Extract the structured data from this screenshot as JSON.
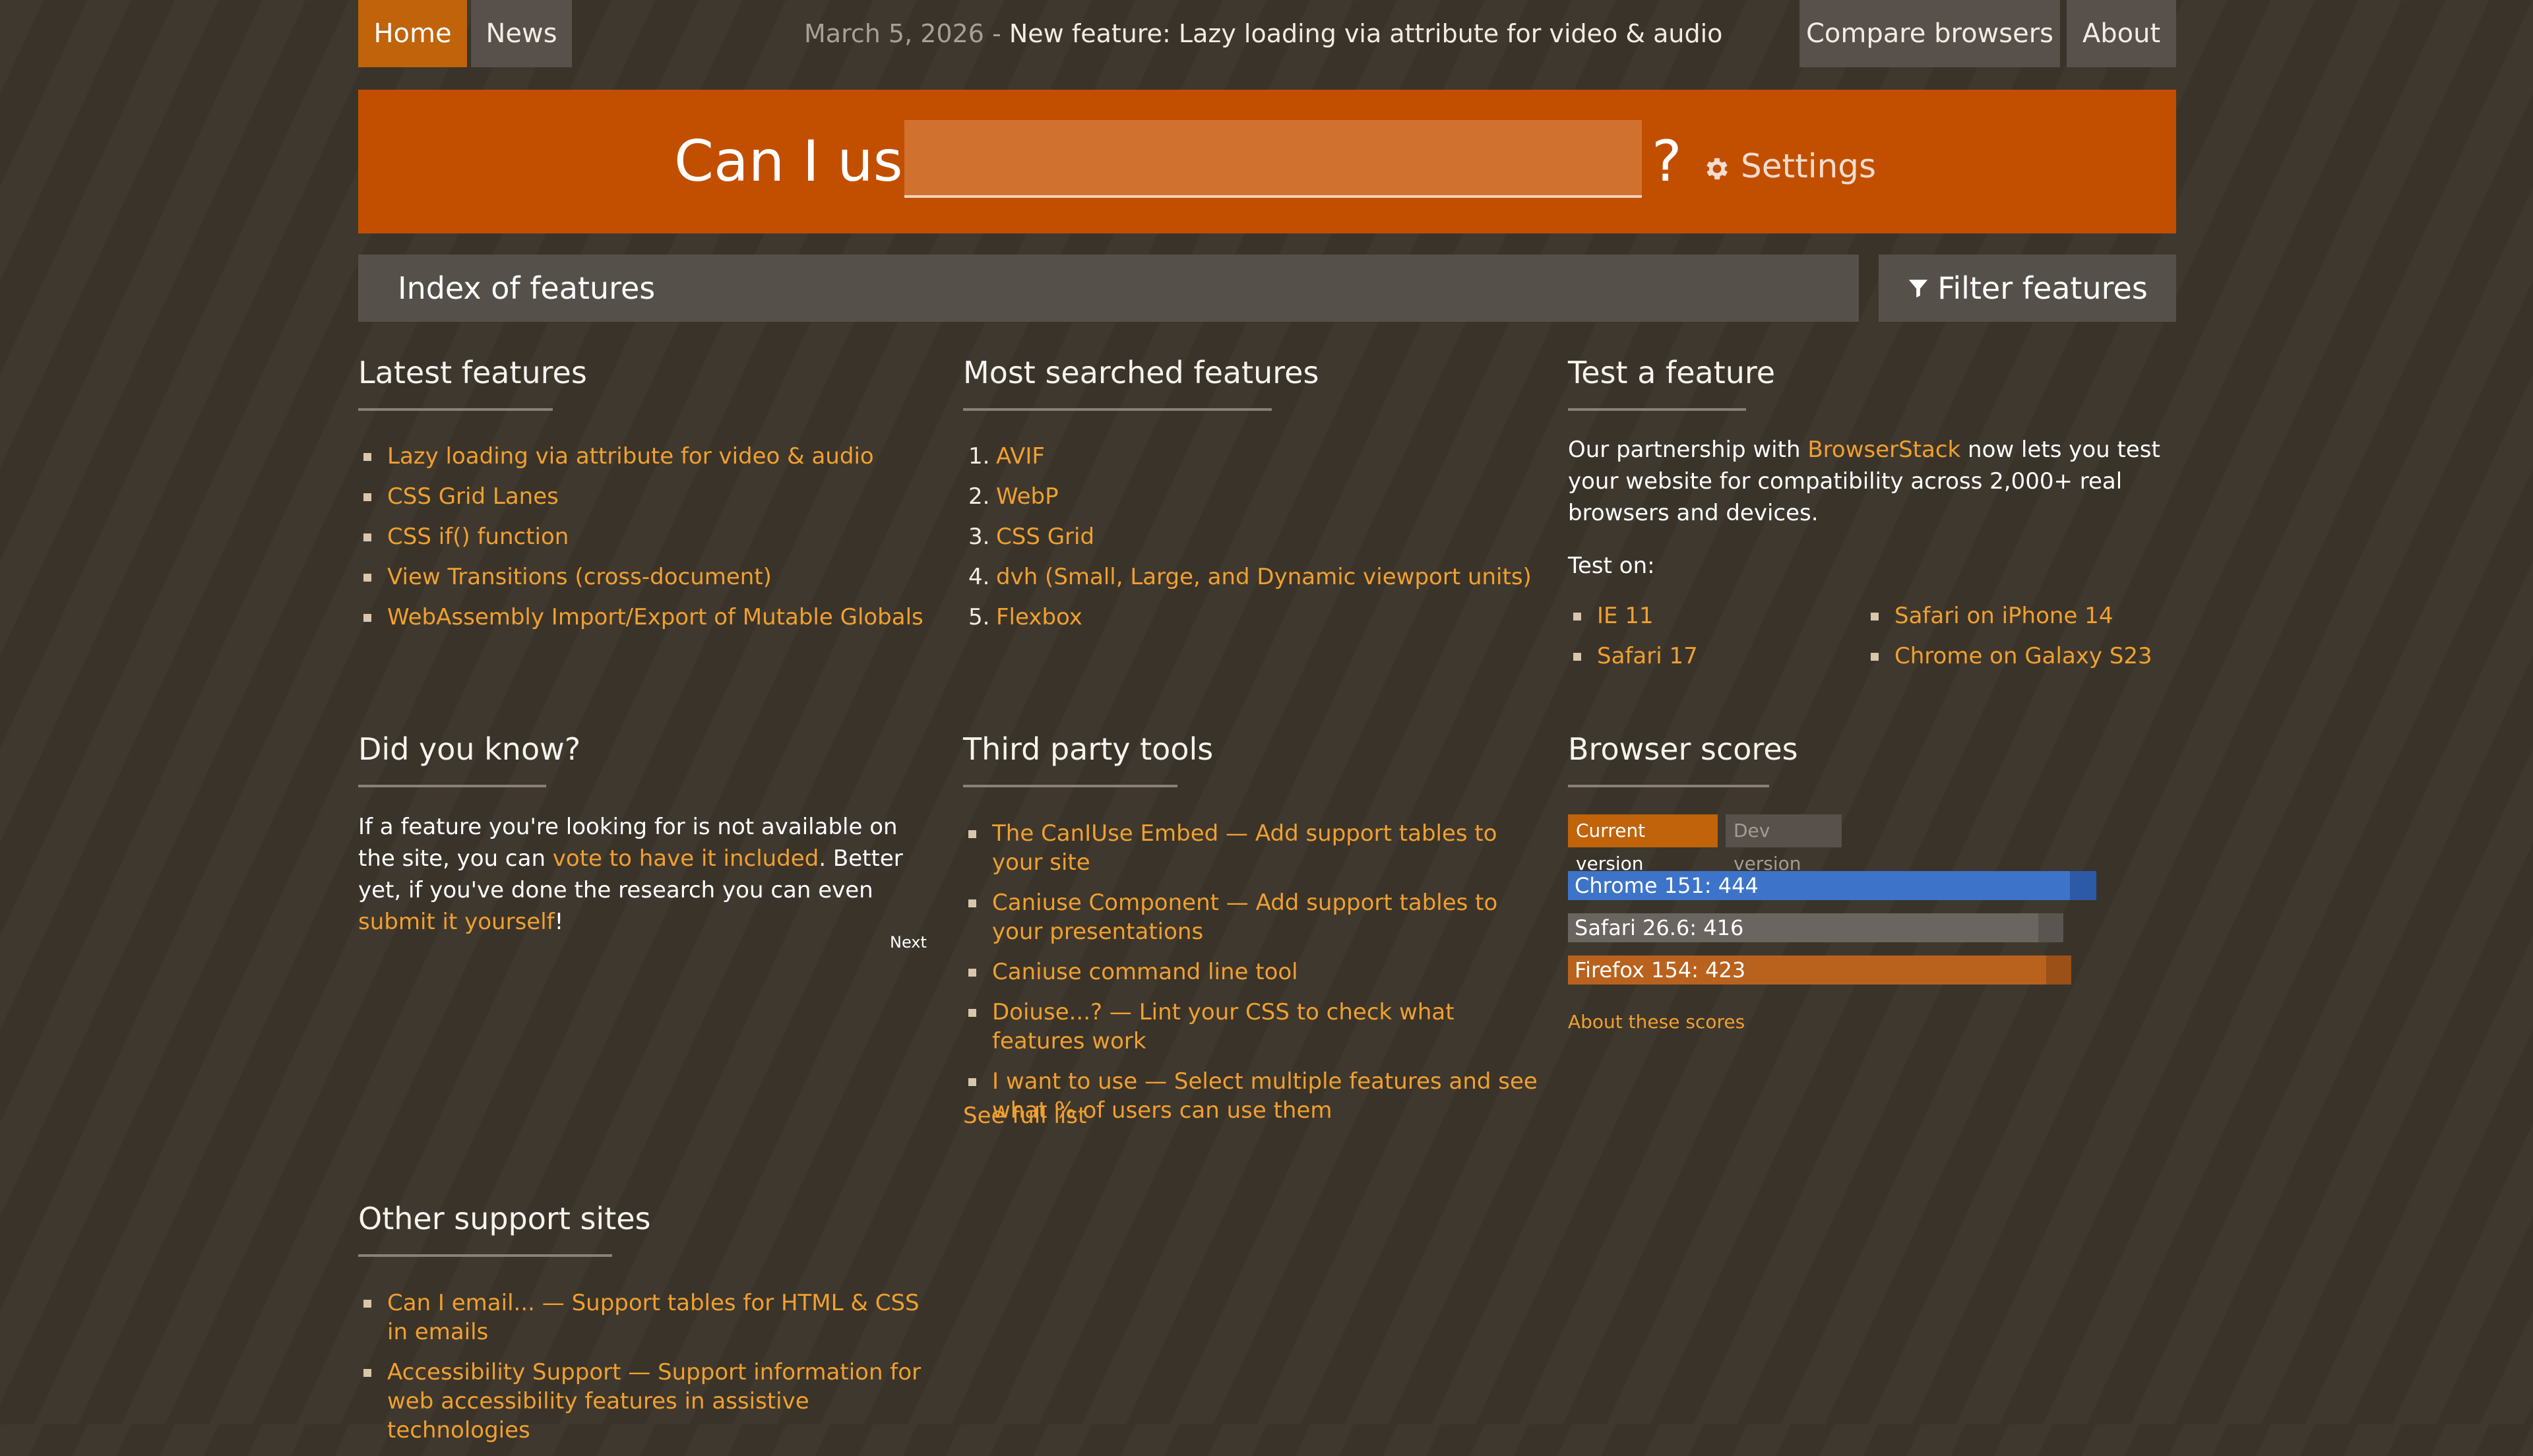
{
  "nav": {
    "home": "Home",
    "news": "News",
    "compare": "Compare browsers",
    "about": "About",
    "news_date": "March 5, 2026",
    "news_sep": "-",
    "news_text": "New feature: Lazy loading via attribute for video & audio"
  },
  "banner": {
    "title": "Can I use",
    "search_value": "",
    "qmark": "?",
    "settings": "Settings"
  },
  "index": {
    "title": "Index of features",
    "filter": "Filter features"
  },
  "latest": {
    "title": "Latest features",
    "items": [
      "Lazy loading via attribute for video & audio",
      "CSS Grid Lanes",
      "CSS if() function",
      "View Transitions (cross-document)",
      "WebAssembly Import/Export of Mutable Globals"
    ]
  },
  "searched": {
    "title": "Most searched features",
    "items": [
      {
        "num": "1.",
        "label": "AVIF"
      },
      {
        "num": "2.",
        "label": "WebP"
      },
      {
        "num": "3.",
        "label": "CSS Grid"
      },
      {
        "num": "4.",
        "label": "dvh (Small, Large, and Dynamic viewport units)"
      },
      {
        "num": "5.",
        "label": "Flexbox"
      }
    ]
  },
  "test": {
    "title": "Test a feature",
    "text_before": "Our partnership with ",
    "link": "BrowserStack",
    "text_after": " now lets you test your website for compatibility across 2,000+ real browsers and devices.",
    "test_on": "Test on:",
    "left": [
      "IE 11",
      "Safari 17"
    ],
    "right": [
      "Safari on iPhone 14",
      "Chrome on Galaxy S23"
    ]
  },
  "didyouknow": {
    "title": "Did you know?",
    "t1": "If a feature you're looking for is not available on the site, you can ",
    "link1": "vote to have it included",
    "t2": ". Better yet, if you've done the research you can even ",
    "link2": "submit it yourself",
    "t3": "!",
    "next": "Next"
  },
  "thirdparty": {
    "title": "Third party tools",
    "items": [
      "The CanIUse Embed — Add support tables to your site",
      "Caniuse Component — Add support tables to your presentations",
      "Caniuse command line tool",
      "Doiuse...? — Lint your CSS to check what features work",
      "I want to use — Select multiple features and see what % of users can use them"
    ],
    "see_full": "See full list"
  },
  "scores": {
    "title": "Browser scores",
    "tab_current": "Current version",
    "tab_dev": "Dev version",
    "max": 460,
    "items": [
      {
        "label": "Chrome 151: 444",
        "value": 444,
        "color": "#3d74c9",
        "track": "#2c5aa6"
      },
      {
        "label": "Safari 26.6: 416",
        "value": 416,
        "color": "#6a6560",
        "track": "#5a5550"
      },
      {
        "label": "Firefox 154: 423",
        "value": 423,
        "color": "#b9621e",
        "track": "#9a5017"
      }
    ],
    "about": "About these scores"
  },
  "other": {
    "title": "Other support sites",
    "items": [
      "Can I email... — Support tables for HTML & CSS in emails",
      "Accessibility Support — Support information for web accessibility features in assistive technologies"
    ]
  }
}
